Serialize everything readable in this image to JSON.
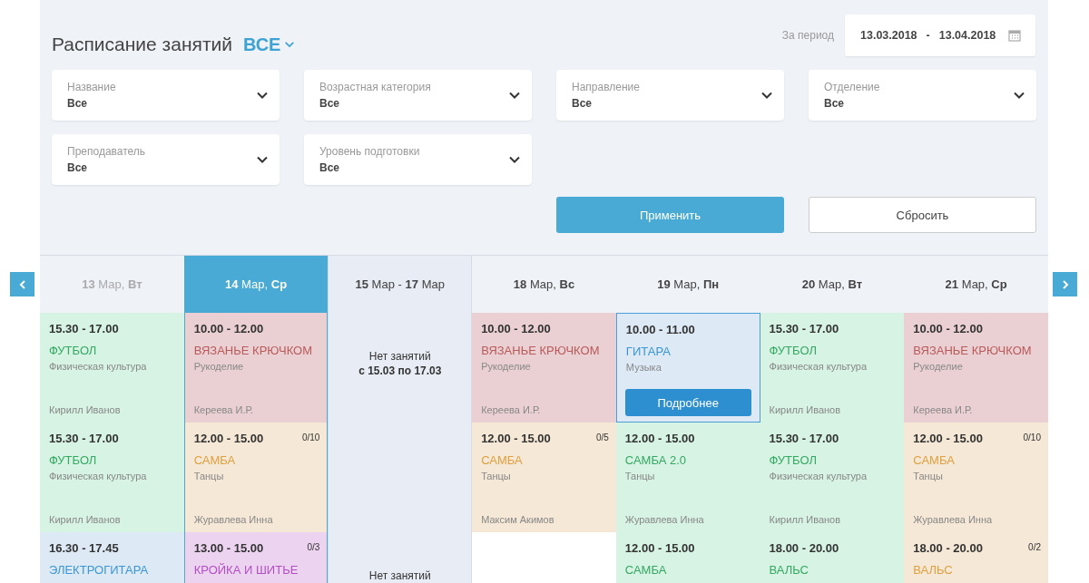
{
  "header": {
    "title": "Расписание занятий",
    "scope": "ВСЕ",
    "period_label": "За период",
    "date_from": "13.03.2018",
    "date_sep": "-",
    "date_to": "13.04.2018"
  },
  "filters": [
    {
      "label": "Название",
      "value": "Все"
    },
    {
      "label": "Возрастная категория",
      "value": "Все"
    },
    {
      "label": "Направление",
      "value": "Все"
    },
    {
      "label": "Отделение",
      "value": "Все"
    },
    {
      "label": "Преподаватель",
      "value": "Все"
    },
    {
      "label": "Уровень подготовки",
      "value": "Все"
    }
  ],
  "buttons": {
    "apply": "Применить",
    "reset": "Сбросить"
  },
  "columns": [
    {
      "kind": "day",
      "header": "**13** Мар, **Вт**",
      "past": true,
      "selected": false,
      "cells": [
        {
          "time": "15.30 - 17.00",
          "title": "ФУТБОЛ",
          "color": "#35a862",
          "category": "Физическая культура",
          "teacher": "Кирилл Иванов",
          "selected": false
        },
        {
          "time": "15.30 - 17.00",
          "title": "ФУТБОЛ",
          "color": "#35a862",
          "category": "Физическая культура",
          "teacher": "Кирилл Иванов",
          "selected": false
        },
        {
          "time": "16.30 - 17.45",
          "title": "ЭЛЕКТРОГИТАРА",
          "color": "#3b97d3",
          "selected": false
        }
      ]
    },
    {
      "kind": "day",
      "header": "**14** Мар, **Ср**",
      "past": false,
      "selected": true,
      "cells": [
        {
          "time": "10.00 - 12.00",
          "title": "ВЯЗАНЬЕ КРЮЧКОМ",
          "color": "#b85a5a",
          "category": "Рукоделие",
          "teacher": "Кереева И.Р.",
          "selected": false
        },
        {
          "time": "12.00 - 15.00",
          "title": "САМБА",
          "color": "#e0a040",
          "category": "Танцы",
          "teacher": "Журавлева Инна",
          "capacity": "0/10",
          "selected": false
        },
        {
          "time": "13.00 - 15.00",
          "title": "КРОЙКА И ШИТЬЕ",
          "color": "#b24fc4",
          "capacity": "0/3",
          "selected": false
        }
      ]
    },
    {
      "kind": "gap",
      "header": "**15** Мар - **17** Мар",
      "notes": [
        {
          "text": "Нет занятий",
          "range": "с 15.03 по 17.03"
        },
        {
          "text": "Нет занятий"
        }
      ]
    },
    {
      "kind": "day",
      "header": "**18** Мар, **Вс**",
      "past": false,
      "selected": false,
      "cells": [
        {
          "time": "10.00 - 12.00",
          "title": "ВЯЗАНЬЕ КРЮЧКОМ",
          "color": "#b85a5a",
          "category": "Рукоделие",
          "teacher": "Кереева И.Р.",
          "selected": false
        },
        {
          "time": "12.00 - 15.00",
          "title": "САМБА",
          "color": "#e0a040",
          "category": "Танцы",
          "teacher": "Максим Акимов",
          "capacity": "0/5",
          "selected": false
        },
        null
      ]
    },
    {
      "kind": "day",
      "header": "**19** Мар, **Пн**",
      "past": false,
      "selected": false,
      "cells": [
        {
          "time": "10.00 - 11.00",
          "title": "ГИТАРА",
          "color": "#3b97d3",
          "category": "Музыка",
          "selected": true,
          "action": "Подробнее"
        },
        {
          "time": "12.00 - 15.00",
          "title": "САМБА 2.0",
          "color": "#35a862",
          "category": "Танцы",
          "teacher": "Журавлева Инна",
          "selected": false
        },
        {
          "time": "12.00 - 15.00",
          "title": "САМБА",
          "color": "#35a862",
          "selected": false
        }
      ]
    },
    {
      "kind": "day",
      "header": "**20** Мар, **Вт**",
      "past": false,
      "selected": false,
      "cells": [
        {
          "time": "15.30 - 17.00",
          "title": "ФУТБОЛ",
          "color": "#35a862",
          "category": "Физическая культура",
          "teacher": "Кирилл Иванов",
          "selected": false
        },
        {
          "time": "15.30 - 17.00",
          "title": "ФУТБОЛ",
          "color": "#35a862",
          "category": "Физическая культура",
          "teacher": "Кирилл Иванов",
          "selected": false
        },
        {
          "time": "18.00 - 20.00",
          "title": "ВАЛЬС",
          "color": "#35a862",
          "selected": false
        }
      ]
    },
    {
      "kind": "day",
      "header": "**21** Мар, **Ср**",
      "past": false,
      "selected": false,
      "cells": [
        {
          "time": "10.00 - 12.00",
          "title": "ВЯЗАНЬЕ КРЮЧКОМ",
          "color": "#b85a5a",
          "category": "Рукоделие",
          "teacher": "Кереева И.Р.",
          "selected": false
        },
        {
          "time": "12.00 - 15.00",
          "title": "САМБА",
          "color": "#e0a040",
          "category": "Танцы",
          "teacher": "Журавлева Инна",
          "capacity": "0/10",
          "selected": false
        },
        {
          "time": "18.00 - 20.00",
          "title": "ВАЛЬС",
          "color": "#e0a040",
          "capacity": "0/2",
          "selected": false
        }
      ]
    }
  ]
}
